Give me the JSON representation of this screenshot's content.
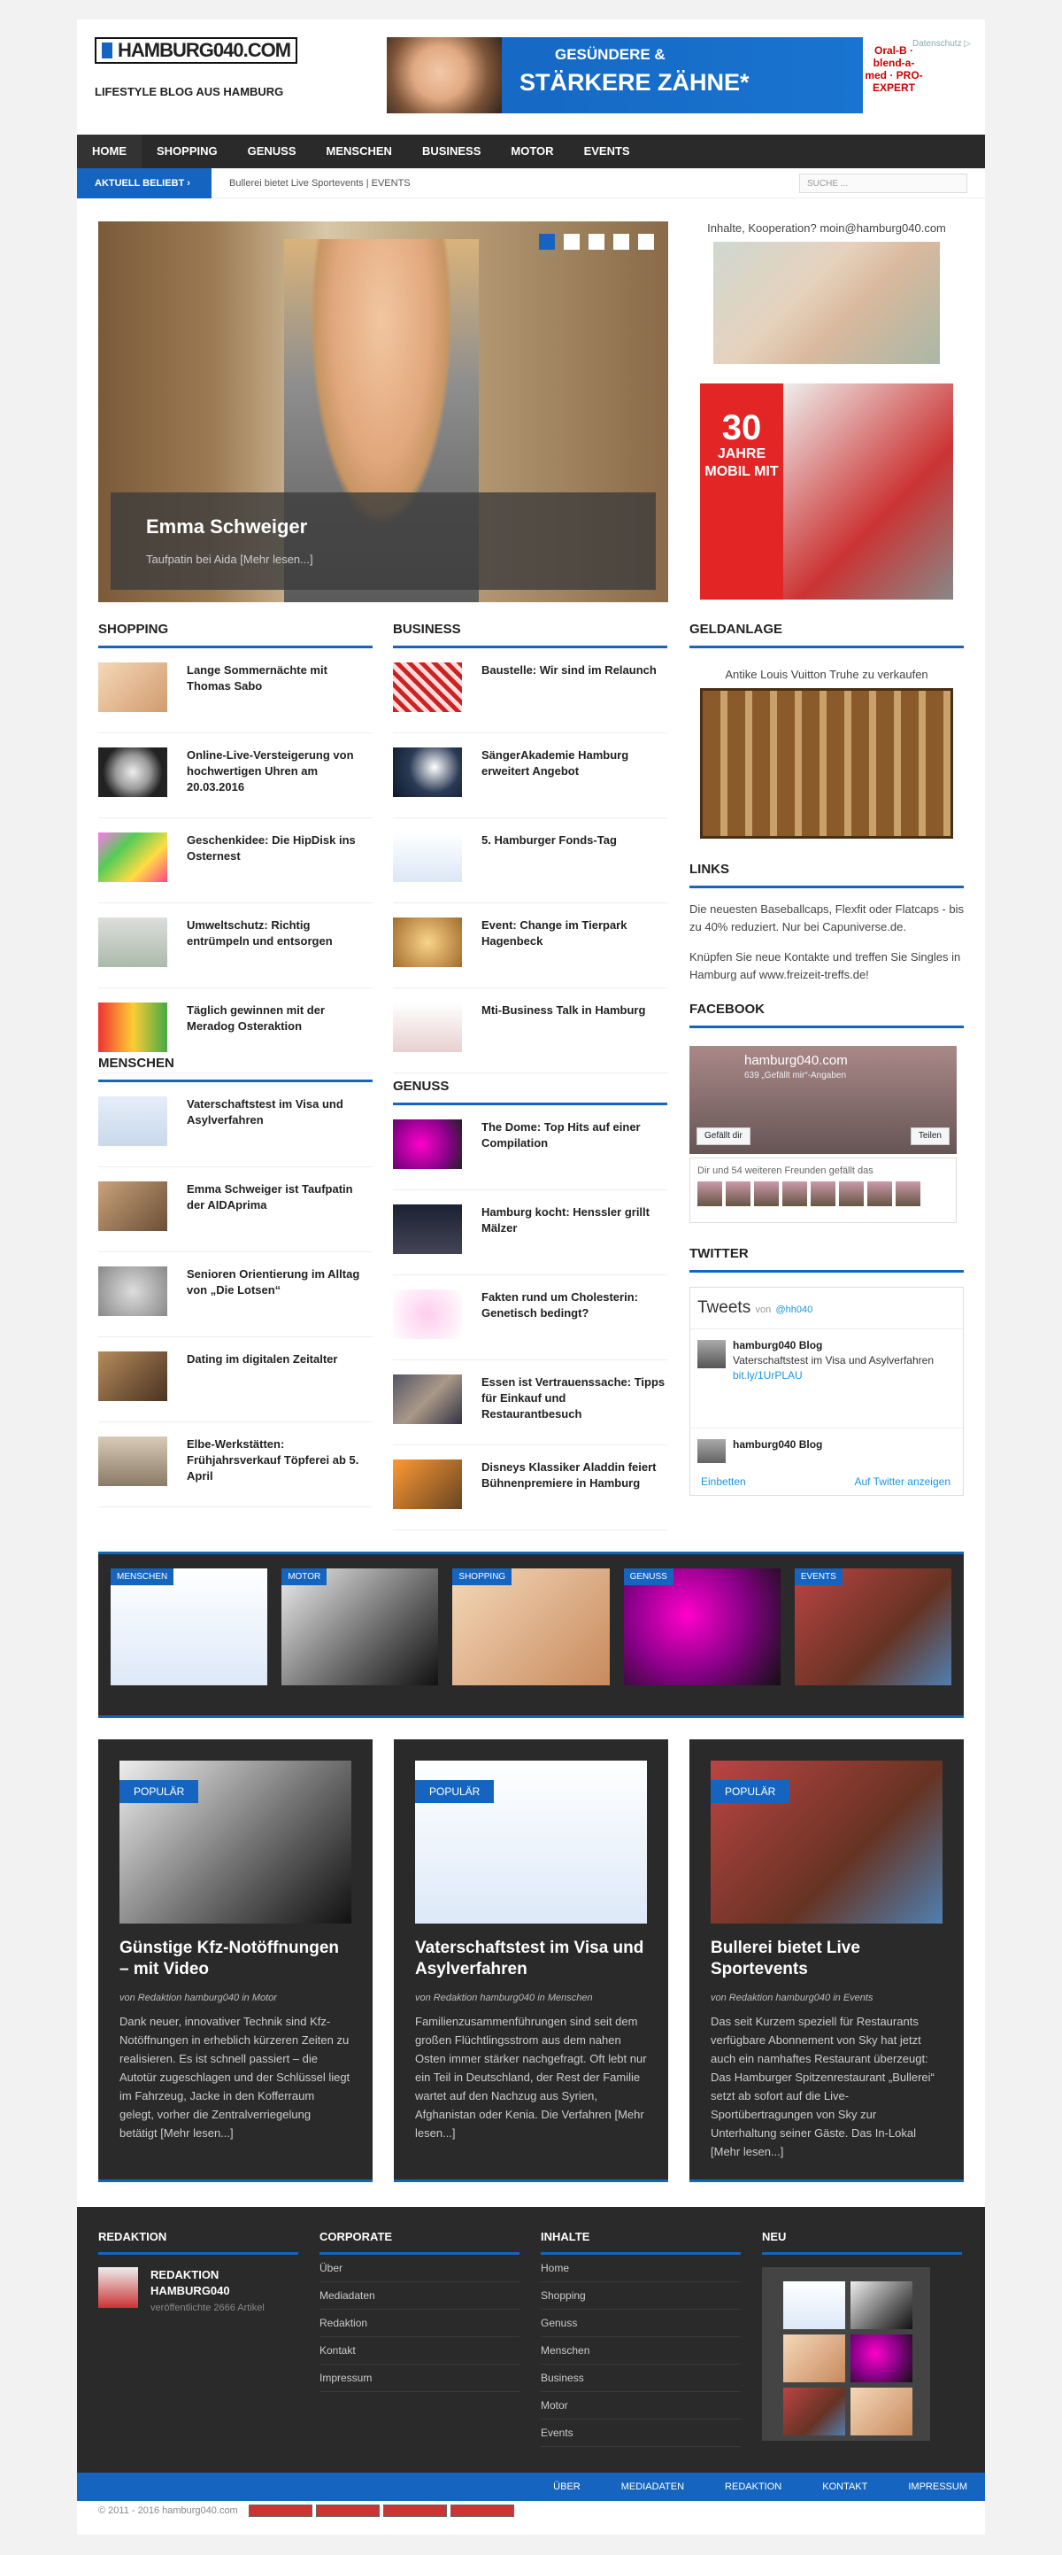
{
  "header": {
    "logo": "HAMBURG040.COM",
    "tagline": "LIFESTYLE BLOG AUS HAMBURG",
    "ad_label": "Datenschutz ▷"
  },
  "banner": {
    "line1": "GESÜNDERE &",
    "line2": "STÄRKERE ZÄHNE*",
    "brand": "Oral-B · blend-a-med · PRO-EXPERT"
  },
  "nav": [
    "HOME",
    "SHOPPING",
    "GENUSS",
    "MENSCHEN",
    "BUSINESS",
    "MOTOR",
    "EVENTS"
  ],
  "trend": {
    "label": "AKTUELL BELIEBT ›",
    "text": "Bullerei bietet Live Sportevents  |  EVENTS",
    "search_placeholder": "SUCHE ..."
  },
  "slider": {
    "title": "Emma Schweiger",
    "sub": "Taufpatin bei Aida [Mehr lesen...]"
  },
  "side_top": {
    "text": "Inhalte, Kooperation? moin@hamburg040.com",
    "ad": "30",
    "ad2": "JAHRE",
    "ad3": "MOBIL MIT"
  },
  "shopping": {
    "title": "SHOPPING",
    "items": [
      "Lange Sommernächte mit Thomas Sabo",
      "Online-Live-Versteigerung von hochwertigen Uhren am 20.03.2016",
      "Geschenkidee: Die HipDisk ins Osternest",
      "Umweltschutz: Richtig entrümpeln und entsorgen",
      "Täglich gewinnen mit der Meradog Osteraktion"
    ]
  },
  "menschen": {
    "title": "MENSCHEN",
    "items": [
      "Vaterschaftstest im Visa und Asylverfahren",
      "Emma Schweiger ist Taufpatin der AIDAprima",
      "Senioren Orientierung im Alltag von „Die Lotsen“",
      "Dating im digitalen Zeitalter",
      "Elbe-Werkstätten: Frühjahrsverkauf Töpferei ab 5. April"
    ]
  },
  "business": {
    "title": "BUSINESS",
    "items": [
      "Baustelle: Wir sind im Relaunch",
      "SängerAkademie Hamburg erweitert Angebot",
      "5. Hamburger Fonds-Tag",
      "Event: Change im Tierpark Hagenbeck",
      "Mti-Business Talk in Hamburg"
    ]
  },
  "genuss": {
    "title": "GENUSS",
    "items": [
      "The Dome: Top Hits auf einer Compilation",
      "Hamburg kocht: Henssler grillt Mälzer",
      "Fakten rund um Cholesterin: Genetisch bedingt?",
      "Essen ist Vertrauenssache: Tipps für Einkauf und Restaurantbesuch",
      "Disneys Klassiker Aladdin feiert Bühnenpremiere in Hamburg"
    ]
  },
  "geldanlage": {
    "title": "GELDANLAGE",
    "text": "Antike Louis Vuitton Truhe zu verkaufen"
  },
  "links": {
    "title": "LINKS",
    "p1": "Die neuesten Baseballcaps, Flexfit oder Flatcaps - bis zu 40% reduziert. Nur bei Capuniverse.de.",
    "p2": "Knüpfen Sie neue Kontakte und treffen Sie Singles in Hamburg auf www.freizeit-treffs.de!"
  },
  "facebook": {
    "title": "FACEBOOK",
    "name": "hamburg040.com",
    "count": "639 „Gefällt mir“-Angaben",
    "like": "Gefällt dir",
    "share": "Teilen",
    "friends": "Dir und 54 weiteren Freunden gefällt das"
  },
  "twitter": {
    "title": "TWITTER",
    "head": "Tweets",
    "von": "von",
    "handle": "@hh040",
    "t1_name": "hamburg040 Blog",
    "t1_text": "Vaterschaftstest im Visa und Asylverfahren",
    "t1_link": "bit.ly/1UrPLAU",
    "t2_name": "hamburg040 Blog",
    "embed": "Einbetten",
    "view": "Auf Twitter anzeigen"
  },
  "strip": [
    "MENSCHEN",
    "MOTOR",
    "SHOPPING",
    "GENUSS",
    "EVENTS"
  ],
  "cards": [
    {
      "tag": "POPULÄR",
      "title": "Günstige Kfz-Notöffnungen – mit Video",
      "meta": "von Redaktion hamburg040 in Motor",
      "text": "Dank neuer, innovativer Technik sind Kfz-Notöffnungen in erheblich kürzeren Zeiten zu realisieren. Es ist schnell passiert – die Autotür zugeschlagen und der Schlüssel liegt im Fahrzeug, Jacke in den Kofferraum gelegt, vorher die Zentralverriegelung betätigt [Mehr lesen...]"
    },
    {
      "tag": "POPULÄR",
      "title": "Vaterschaftstest im Visa und Asylverfahren",
      "meta": "von Redaktion hamburg040 in Menschen",
      "text": "Familienzusammenführungen sind seit dem großen Flüchtlingsstrom aus dem nahen Osten immer stärker nachgefragt. Oft lebt nur ein Teil in Deutschland, der Rest der Familie wartet auf den Nachzug aus Syrien, Afghanistan oder Kenia. Die Verfahren [Mehr lesen...]"
    },
    {
      "tag": "POPULÄR",
      "title": "Bullerei bietet Live Sportevents",
      "meta": "von Redaktion hamburg040 in Events",
      "text": "Das seit Kurzem speziell für Restaurants verfügbare Abonnement von Sky hat jetzt auch ein namhaftes Restaurant überzeugt: Das Hamburger Spitzenrestaurant „Bullerei“ setzt ab sofort auf die Live-Sportübertragungen von Sky zur Unterhaltung seiner Gäste. Das In-Lokal [Mehr lesen...]"
    }
  ],
  "footer": {
    "redaktion": {
      "title": "REDAKTION",
      "name": "REDAKTION HAMBURG040",
      "sub": "veröffentlichte 2666 Artikel"
    },
    "corporate": {
      "title": "CORPORATE",
      "items": [
        "Über",
        "Mediadaten",
        "Redaktion",
        "Kontakt",
        "Impressum"
      ]
    },
    "inhalte": {
      "title": "INHALTE",
      "items": [
        "Home",
        "Shopping",
        "Genuss",
        "Menschen",
        "Business",
        "Motor",
        "Events"
      ]
    },
    "neu": {
      "title": "NEU"
    },
    "bar": [
      "ÜBER",
      "MEDIADATEN",
      "REDAKTION",
      "KONTAKT",
      "IMPRESSUM"
    ],
    "copy": "© 2011 - 2016 hamburg040.com"
  }
}
